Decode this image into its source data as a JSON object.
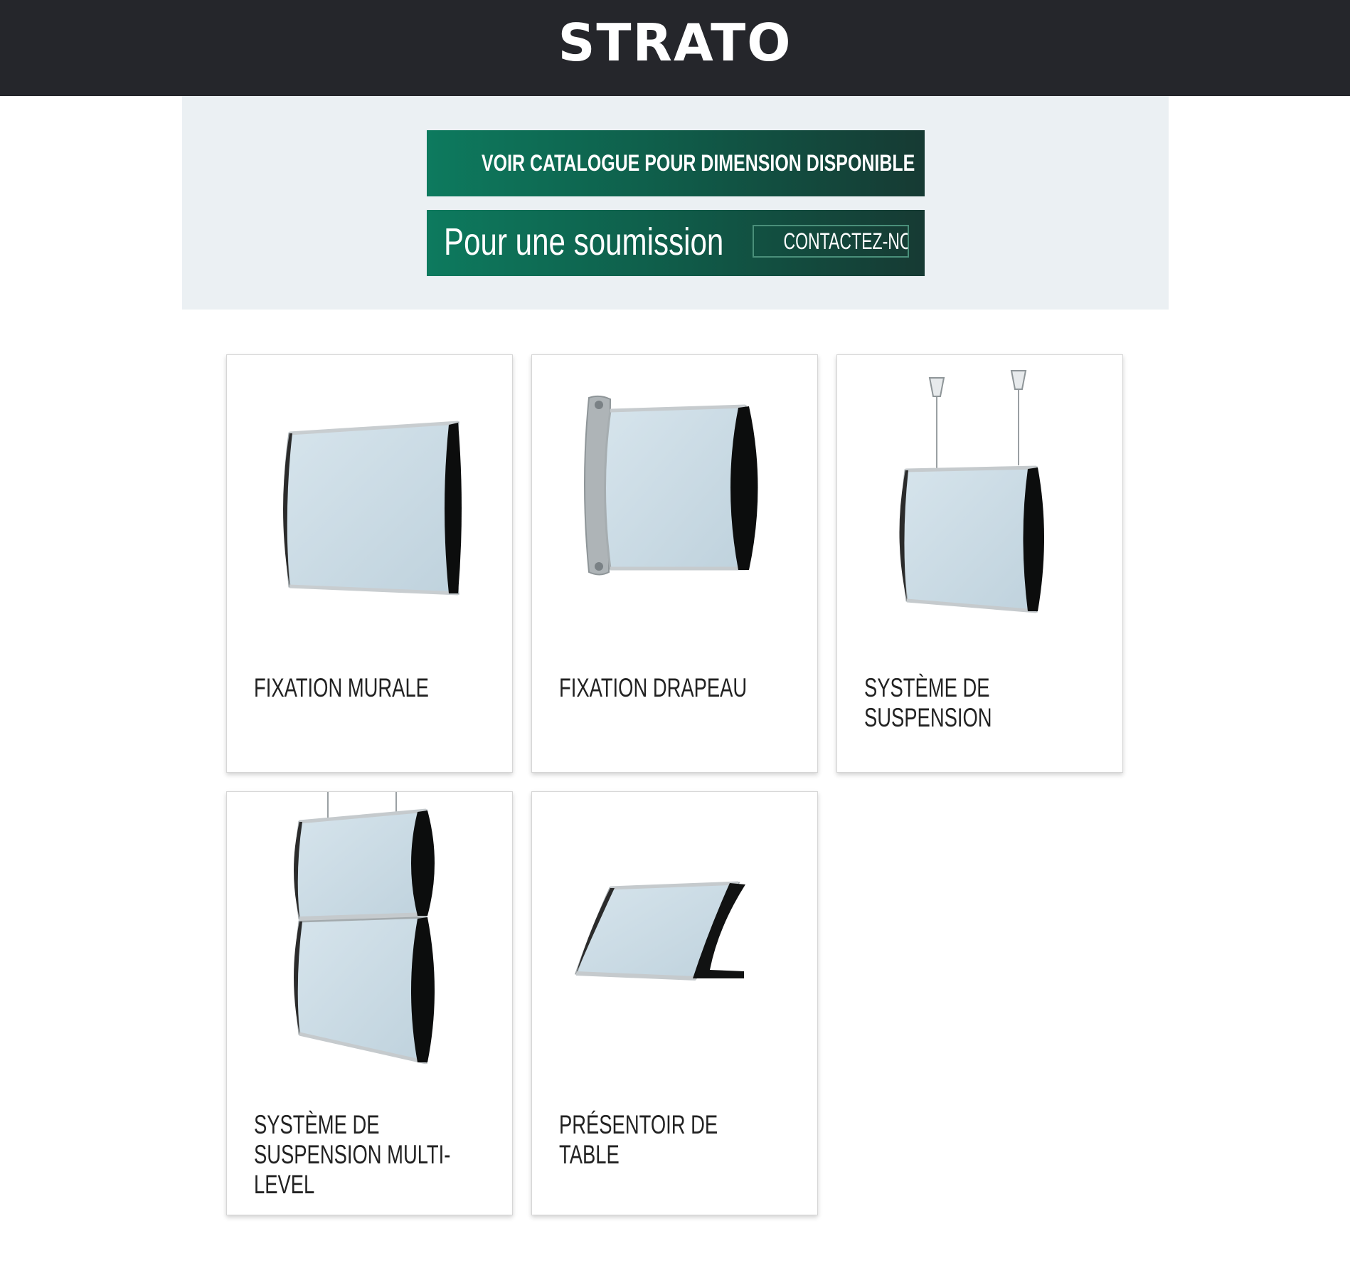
{
  "header": {
    "title": "STRATO"
  },
  "promo": {
    "catalog_button": "VOIR CATALOGUE POUR DIMENSION DISPONIBLE",
    "quote_text": "Pour une soumission",
    "contact_button": "CONTACTEZ-NOUS"
  },
  "products": [
    {
      "label": "FIXATION MURALE",
      "icon": "wall-mount-sign-icon"
    },
    {
      "label": "FIXATION DRAPEAU",
      "icon": "flag-mount-sign-icon"
    },
    {
      "label": "SYSTÈME DE SUSPENSION",
      "icon": "suspension-sign-icon"
    },
    {
      "label": "SYSTÈME DE SUSPENSION MULTI-LEVEL",
      "icon": "multi-level-suspension-sign-icon"
    },
    {
      "label": "PRÉSENTOIR DE TABLE",
      "icon": "table-display-sign-icon"
    }
  ],
  "colors": {
    "header_bg": "#25262b",
    "promo_bg": "#ebf0f3",
    "button_green": "#0f5f4b"
  }
}
